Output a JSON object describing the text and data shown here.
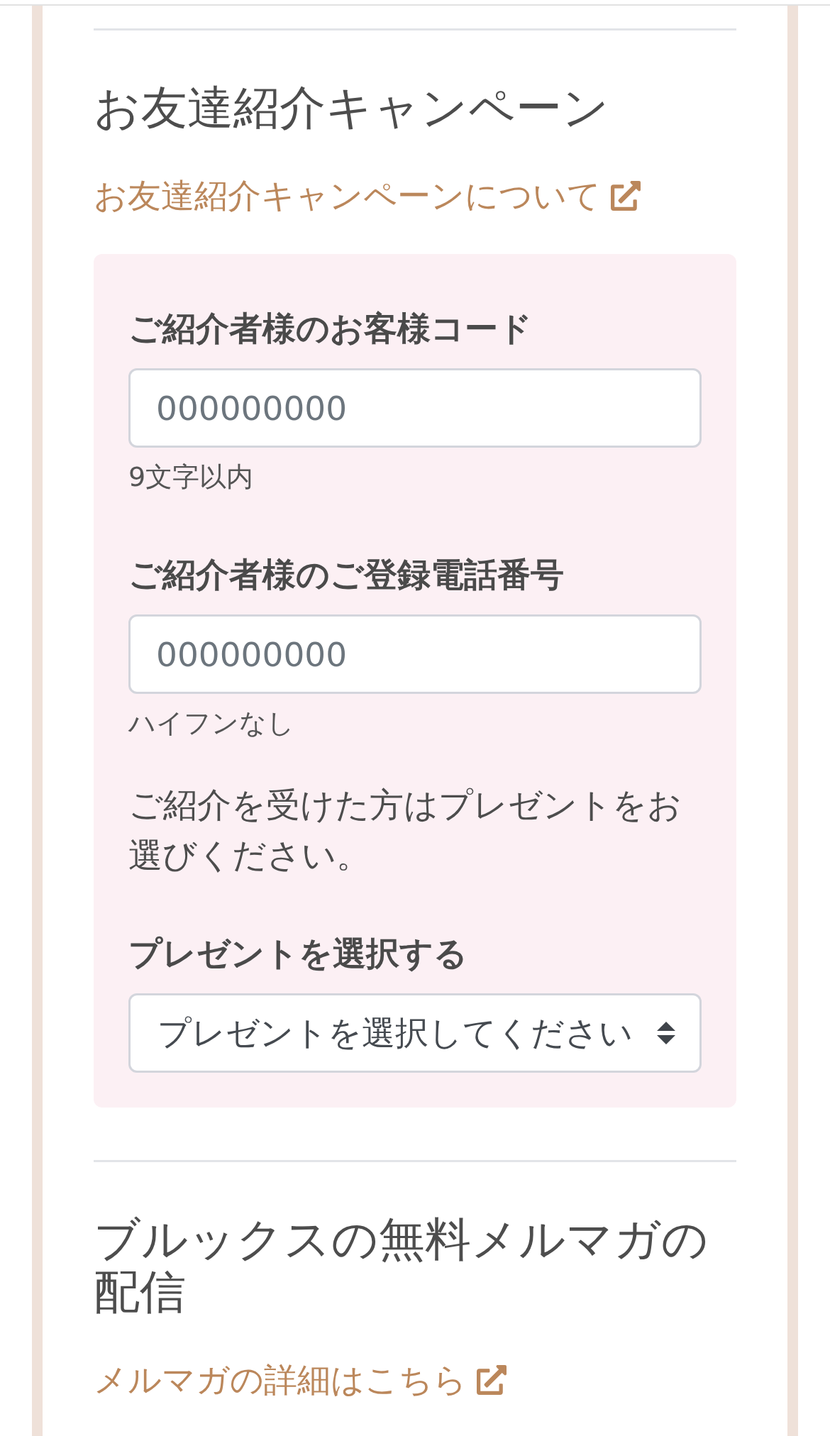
{
  "sections": [
    {
      "title": "お友達紹介キャンペーン",
      "link": "お友達紹介キャンペーンについて",
      "form": {
        "items": [
          {
            "kind": "input",
            "label": "ご紹介者様のお客様コード",
            "placeholder": "000000000",
            "help": "9文字以内"
          },
          {
            "kind": "input",
            "label": "ご紹介者様のご登録電話番号",
            "placeholder": "000000000",
            "help": "ハイフンなし"
          },
          {
            "kind": "text",
            "text": "ご紹介を受けた方はプレゼントをお選びください。"
          },
          {
            "kind": "select",
            "label": "プレゼントを選択する",
            "value": "プレゼントを選択してください"
          }
        ]
      }
    },
    {
      "title": "ブルックスの無料メルマガの配信",
      "link": "メルマガの詳細はこちら"
    }
  ]
}
